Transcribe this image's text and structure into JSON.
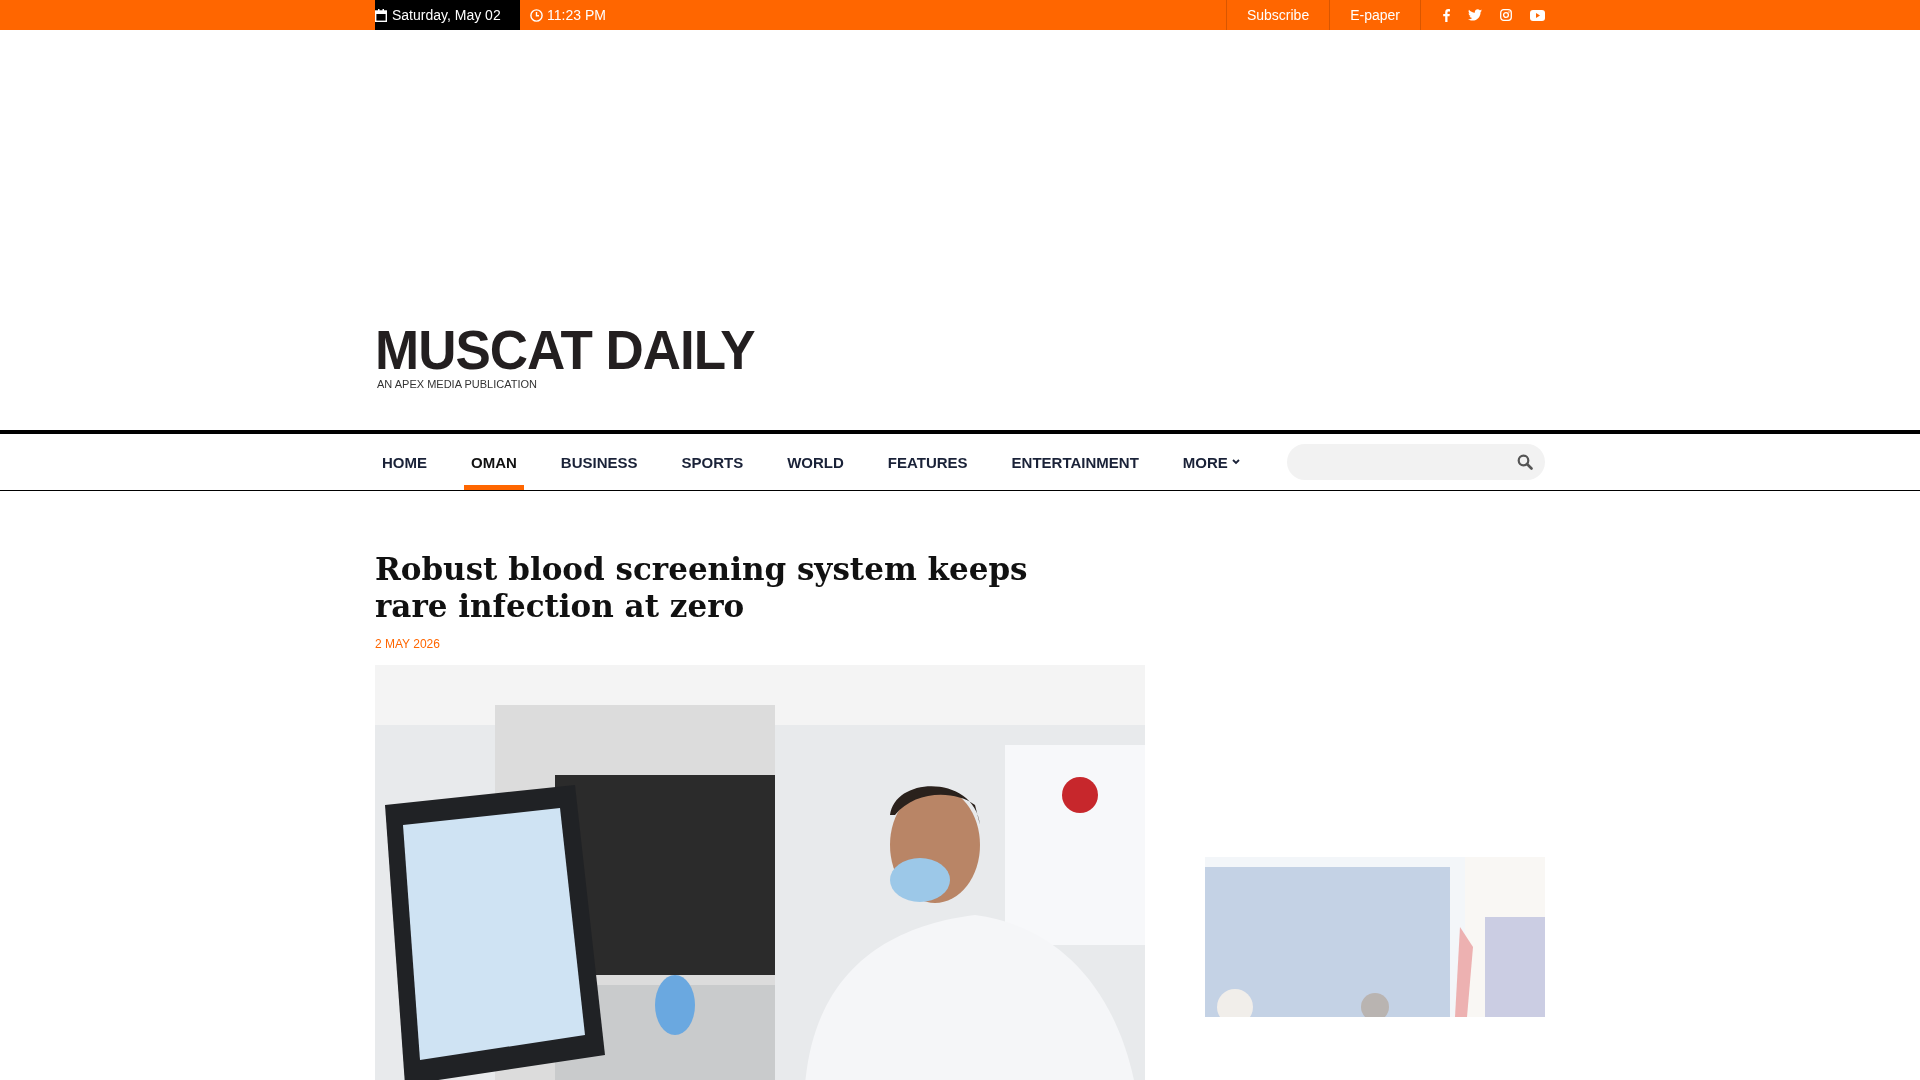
{
  "top_bar": {
    "date": "Saturday, May 02",
    "time": "11:23 PM",
    "links": [
      "Subscribe",
      "E-paper"
    ]
  },
  "masthead": {
    "title": "MUSCAT DAILY",
    "tagline": "AN APEX MEDIA PUBLICATION"
  },
  "nav": {
    "items": [
      {
        "label": "HOME",
        "selected": false
      },
      {
        "label": "OMAN",
        "selected": true
      },
      {
        "label": "BUSINESS",
        "selected": false
      },
      {
        "label": "SPORTS",
        "selected": false
      },
      {
        "label": "WORLD",
        "selected": false
      },
      {
        "label": "FEATURES",
        "selected": false
      },
      {
        "label": "ENTERTAINMENT",
        "selected": false
      },
      {
        "label": "MORE",
        "selected": false,
        "kind": "dropdown"
      }
    ]
  },
  "article": {
    "headline": "Robust blood screening system keeps rare infection at zero",
    "date": "2 MAY 2026"
  }
}
